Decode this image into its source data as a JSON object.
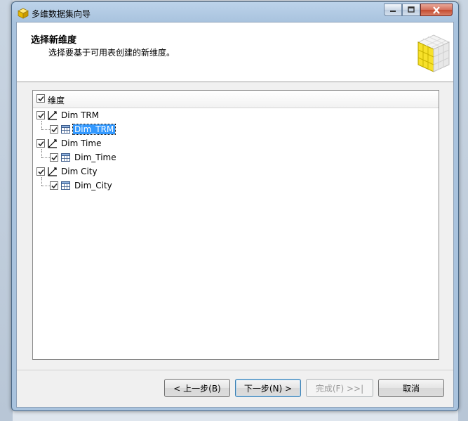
{
  "window": {
    "title": "多维数据集向导"
  },
  "header": {
    "title": "选择新维度",
    "subtitle": "选择要基于可用表创建的新维度。"
  },
  "list": {
    "column_header": "维度",
    "items": [
      {
        "label": "Dim TRM",
        "checked": true,
        "child": {
          "label": "Dim_TRM",
          "checked": true,
          "selected": true
        }
      },
      {
        "label": "Dim Time",
        "checked": true,
        "child": {
          "label": "Dim_Time",
          "checked": true,
          "selected": false
        }
      },
      {
        "label": "Dim City",
        "checked": true,
        "child": {
          "label": "Dim_City",
          "checked": true,
          "selected": false
        }
      }
    ]
  },
  "buttons": {
    "back": "< 上一步(B)",
    "next": "下一步(N) >",
    "finish": "完成(F) >>|",
    "cancel": "取消"
  },
  "colors": {
    "selection": "#3399ff",
    "accent_check": "#2a62a8"
  }
}
